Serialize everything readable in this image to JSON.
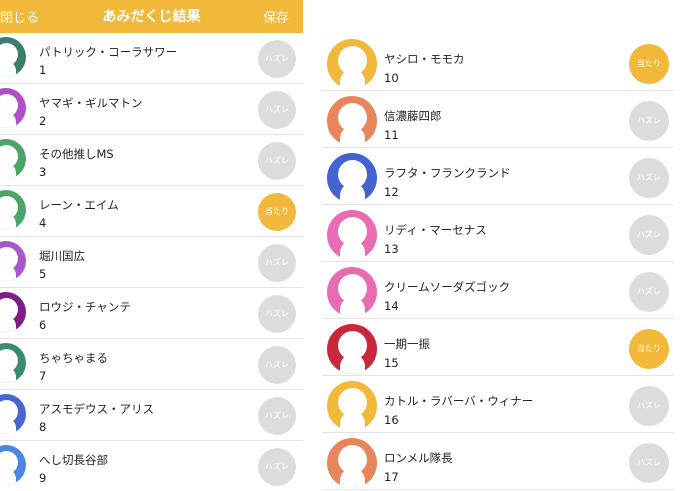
{
  "header": {
    "close_label": "閉じる",
    "title": "あみだくじ結果",
    "save_label": "保存"
  },
  "badge_labels": {
    "hit": "当たり",
    "miss": "ハズレ"
  },
  "colors": {
    "accent": "#f2b83a",
    "miss": "#dcdcdc"
  },
  "left_rows": [
    {
      "name": "パトリック・コーラサワー",
      "number": "1",
      "result": "ハズレ",
      "avatar_color": "#3a7e6c"
    },
    {
      "name": "ヤマギ・ギルマトン",
      "number": "2",
      "result": "ハズレ",
      "avatar_color": "#b04fc9"
    },
    {
      "name": "その他推しMS",
      "number": "3",
      "result": "ハズレ",
      "avatar_color": "#4da46a"
    },
    {
      "name": "レーン・エイム",
      "number": "4",
      "result": "当たり",
      "avatar_color": "#4da46a"
    },
    {
      "name": "堀川国広",
      "number": "5",
      "result": "ハズレ",
      "avatar_color": "#a858c9"
    },
    {
      "name": "ロウジ・チャンテ",
      "number": "6",
      "result": "ハズレ",
      "avatar_color": "#7c1f87"
    },
    {
      "name": "ちゃちゃまる",
      "number": "7",
      "result": "ハズレ",
      "avatar_color": "#3b8a74"
    },
    {
      "name": "アスモデウス・アリス",
      "number": "8",
      "result": "ハズレ",
      "avatar_color": "#4766d2"
    },
    {
      "name": "へし切長谷部",
      "number": "9",
      "result": "ハズレ",
      "avatar_color": "#4b86e0"
    }
  ],
  "right_rows": [
    {
      "name": "ヤシロ・モモカ",
      "number": "10",
      "result": "当たり",
      "avatar_color": "#f2b83a"
    },
    {
      "name": "信濃藤四郎",
      "number": "11",
      "result": "ハズレ",
      "avatar_color": "#e9855a"
    },
    {
      "name": "ラフタ・フランクランド",
      "number": "12",
      "result": "ハズレ",
      "avatar_color": "#4364d0"
    },
    {
      "name": "リディ・マーセナス",
      "number": "13",
      "result": "ハズレ",
      "avatar_color": "#e86cb2"
    },
    {
      "name": "クリームソーダズゴック",
      "number": "14",
      "result": "ハズレ",
      "avatar_color": "#e86cb2"
    },
    {
      "name": "一期一振",
      "number": "15",
      "result": "当たり",
      "avatar_color": "#c9273a"
    },
    {
      "name": "カトル・ラバーバ・ウィナー",
      "number": "16",
      "result": "ハズレ",
      "avatar_color": "#f2b83a"
    },
    {
      "name": "ロンメル隊長",
      "number": "17",
      "result": "ハズレ",
      "avatar_color": "#e9855a"
    }
  ]
}
